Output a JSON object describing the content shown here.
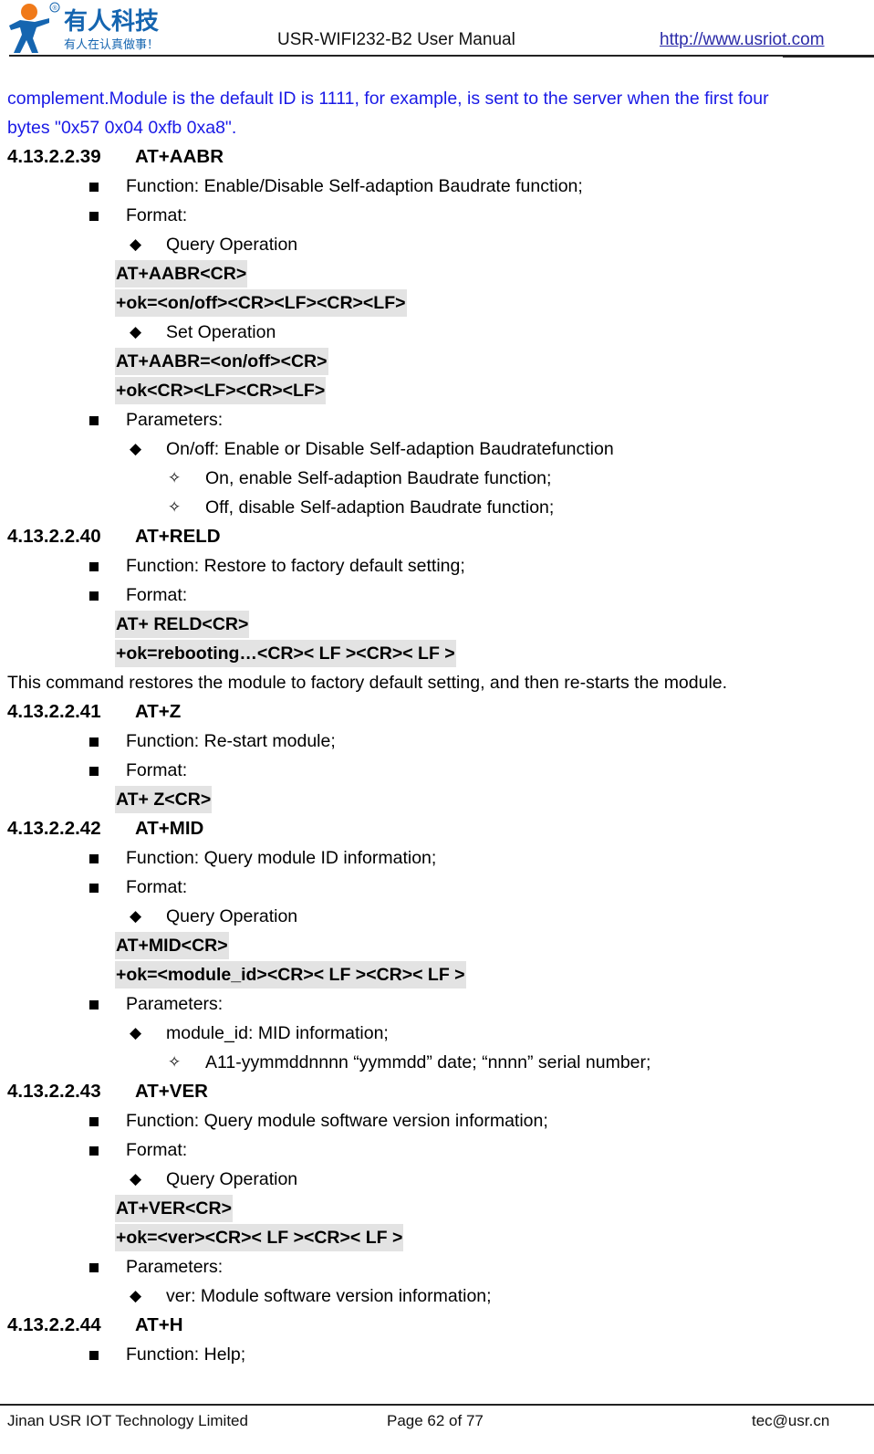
{
  "header": {
    "logo_cn_name": "有人科技",
    "logo_cn_slogan": "有人在认真做事！",
    "logo_registered": "®",
    "title": "USR-WIFI232-B2 User Manual",
    "url": "http://www.usriot.com"
  },
  "intro": {
    "line1": "complement.Module is the default ID is 1111, for example, is sent to the server when the first four",
    "line2": "bytes  \"0x57 0x04 0xfb 0xa8\"."
  },
  "sections": {
    "s39": {
      "number": "4.13.2.2.39",
      "command": "AT+AABR",
      "function": "Function: Enable/Disable Self-adaption Baudrate function;",
      "format": "Format:",
      "query_label": "Query Operation",
      "query_cmd": "AT+AABR<CR>",
      "query_resp": "+ok=<on/off><CR><LF><CR><LF>",
      "set_label": "Set Operation",
      "set_cmd": "AT+AABR=<on/off><CR>",
      "set_resp": "+ok<CR><LF><CR><LF>",
      "params": "Parameters:",
      "param1": "On/off: Enable or Disable  Self-adaption Baudratefunction",
      "param1_opt1": "On, enable  Self-adaption Baudrate function;",
      "param1_opt2": "Off, disable  Self-adaption Baudrate function;"
    },
    "s40": {
      "number": "4.13.2.2.40",
      "command": "AT+RELD",
      "function": "Function: Restore to factory default setting;",
      "format": "Format:",
      "cmd": "AT+ RELD<CR>",
      "resp": "+ok=rebooting…<CR>< LF ><CR>< LF >",
      "note": "This command restores the module to factory default setting, and then re-starts the module."
    },
    "s41": {
      "number": "4.13.2.2.41",
      "command": "AT+Z",
      "function": "Function: Re-start module;",
      "format": "Format:",
      "cmd": "AT+ Z<CR>"
    },
    "s42": {
      "number": "4.13.2.2.42",
      "command": "AT+MID",
      "function": "Function: Query module ID information;",
      "format": "Format:",
      "query_label": "Query Operation",
      "query_cmd": "AT+MID<CR>",
      "query_resp": "+ok=<module_id><CR>< LF ><CR>< LF >",
      "params": "Parameters:",
      "param1": "module_id:  MID information;",
      "param1_opt1": "A11-yymmddnnnn   “yymmdd” date; “nnnn” serial number;"
    },
    "s43": {
      "number": "4.13.2.2.43",
      "command": "AT+VER",
      "function": "Function: Query module software version information;",
      "format": "Format:",
      "query_label": "Query Operation",
      "query_cmd": "AT+VER<CR>",
      "query_resp": "+ok=<ver><CR>< LF ><CR>< LF >",
      "params": "Parameters:",
      "param1": "ver: Module software version information;"
    },
    "s44": {
      "number": "4.13.2.2.44",
      "command": "AT+H",
      "function": "Function: Help;"
    }
  },
  "bullets": {
    "square": "■",
    "diamond": "◆",
    "star": "✧"
  },
  "footer": {
    "company": "Jinan USR IOT Technology Limited",
    "page": "Page 62 of 77",
    "email": "tec@usr.cn"
  },
  "colors": {
    "link": "#2b2ba8",
    "intro_text": "#1a1ae6",
    "code_highlight": "#e3e3e3",
    "logo_blue": "#1565b0",
    "logo_orange": "#f07a1a"
  }
}
